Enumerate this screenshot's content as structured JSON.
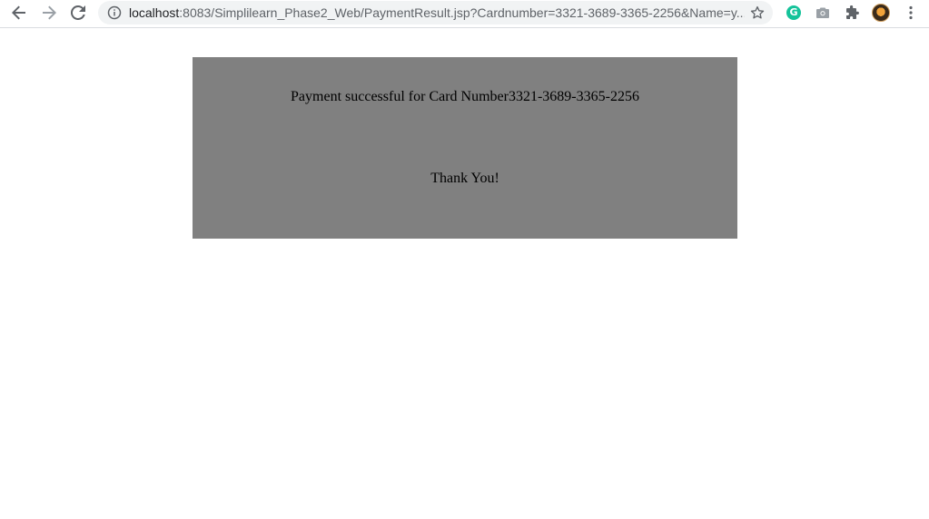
{
  "browser": {
    "url_host": "localhost",
    "url_rest": ":8083/Simplilearn_Phase2_Web/PaymentResult.jsp?Cardnumber=3321-3689-3365-2256&Name=y...",
    "icons": [
      "back-arrow-icon",
      "forward-arrow-icon",
      "reload-icon",
      "info-icon",
      "star-icon",
      "grammarly-icon",
      "camera-icon",
      "puzzle-icon",
      "avatar",
      "more-vert-icon"
    ],
    "grammarly_letter": "G"
  },
  "page": {
    "message_prefix": "Payment successful for Card Number",
    "card_number": "3321-3689-3365-2256",
    "thanks": "Thank You!",
    "box_color": "#808080"
  }
}
